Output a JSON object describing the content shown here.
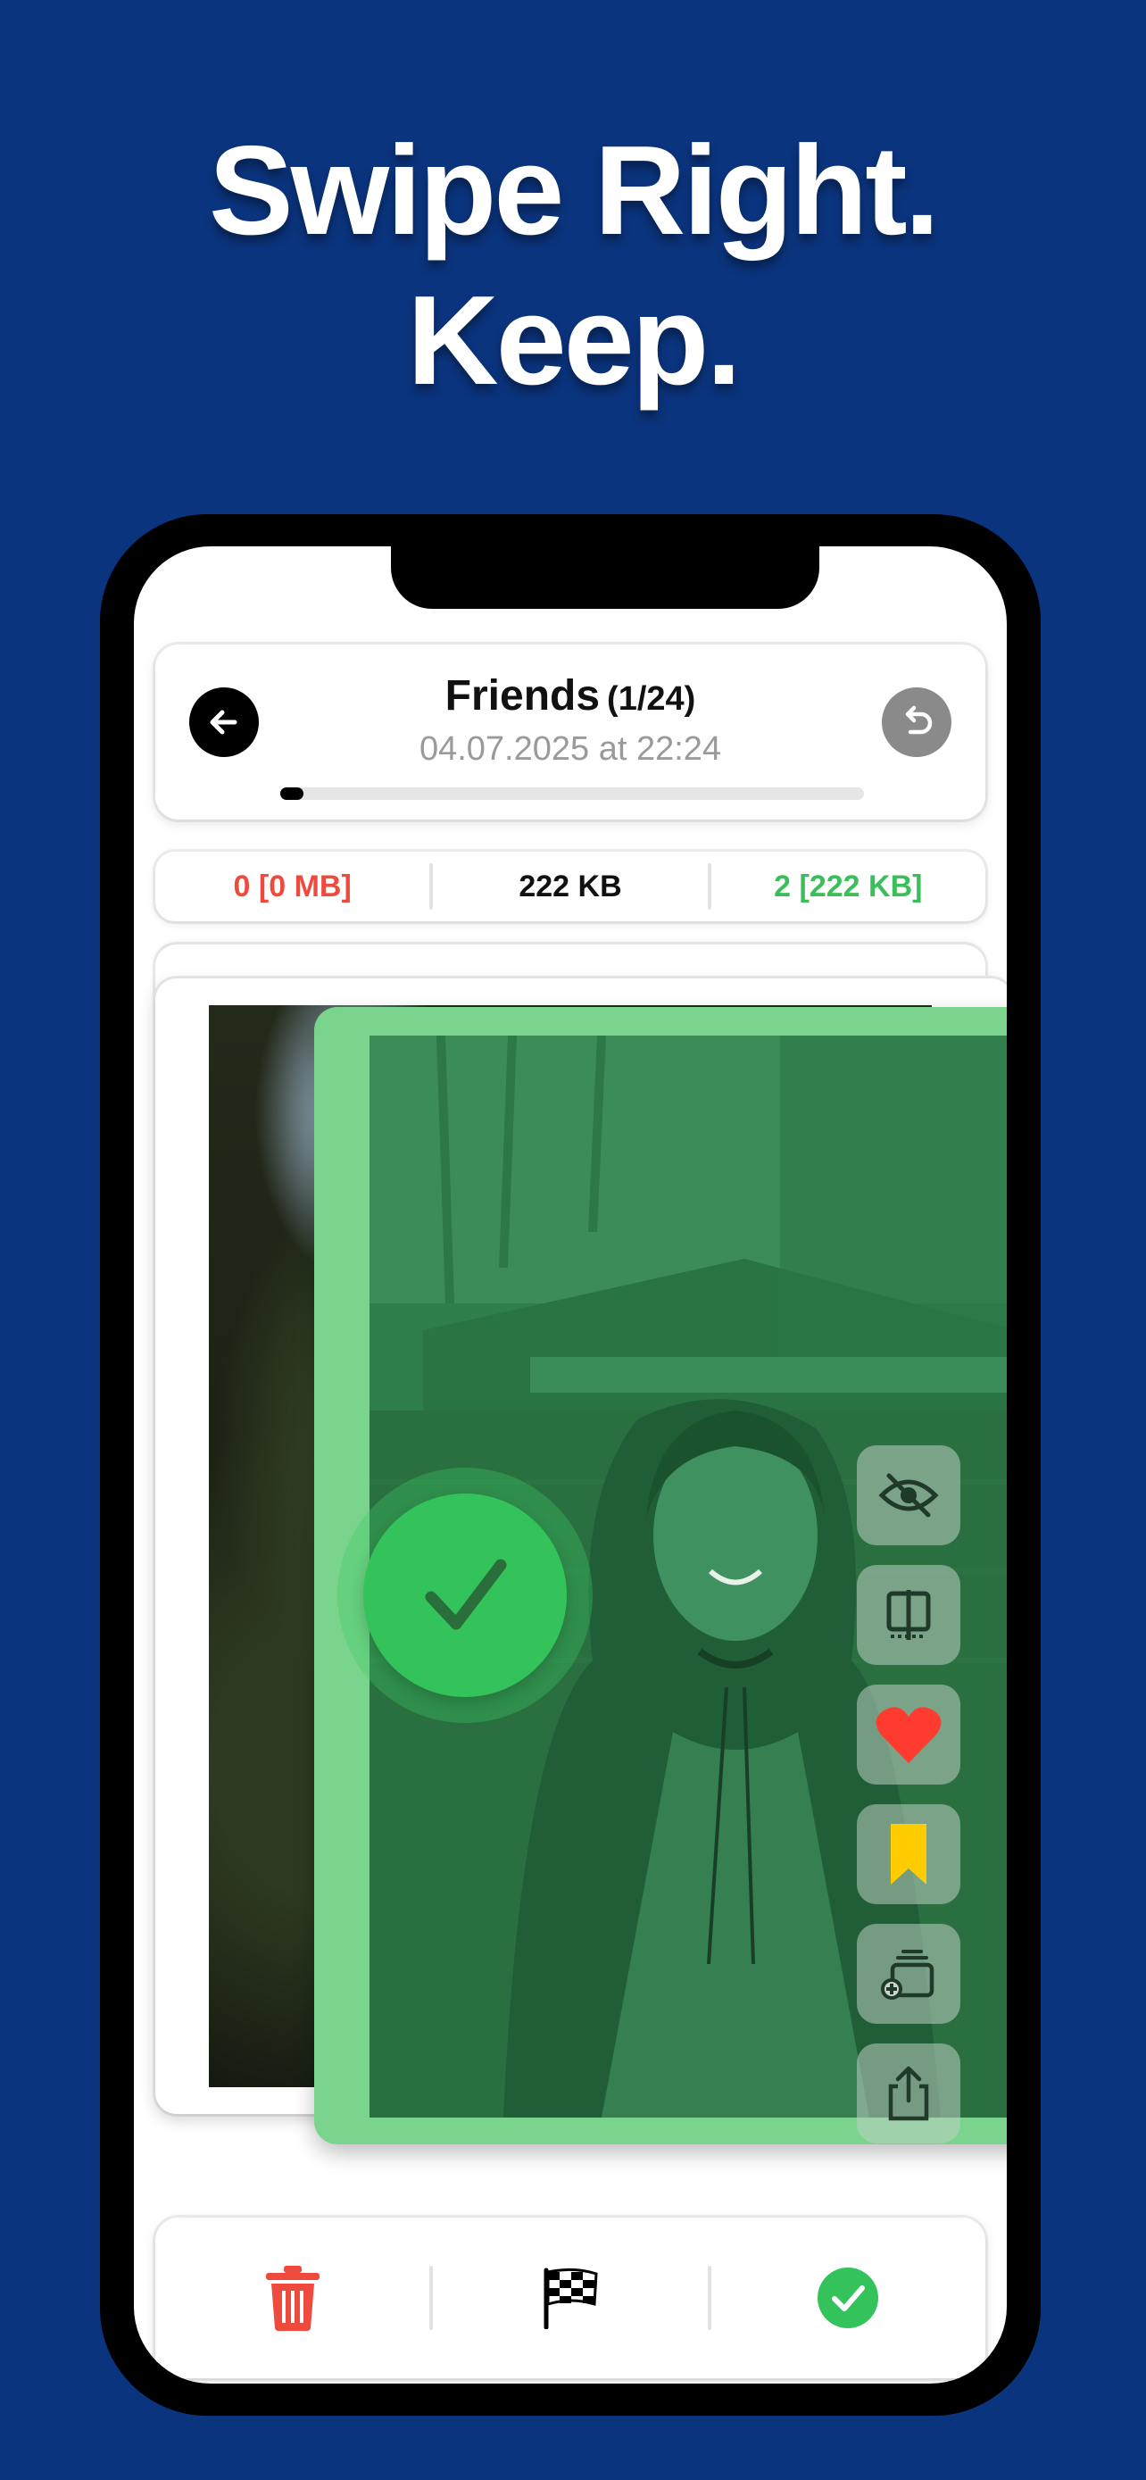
{
  "headline": {
    "line1": "Swipe Right.",
    "line2": "Keep."
  },
  "header": {
    "title": "Friends",
    "counter": "(1/24)",
    "date": "04.07.2025 at 22:24",
    "progress": 0.04
  },
  "stats": {
    "deleted": "0 [0 MB]",
    "current_size": "222 KB",
    "kept": "2 [222 KB]"
  },
  "colors": {
    "background": "#0b347e",
    "delete": "#ee4b3e",
    "keep": "#34c35a",
    "favorite": "#ff3b30",
    "bookmark": "#ffcc00"
  },
  "icons": {
    "back": "arrow-left-icon",
    "undo": "undo-icon",
    "keep_overlay": "checkmark-icon",
    "tools": [
      "eye-slash-icon",
      "compare-icon",
      "heart-icon",
      "bookmark-icon",
      "add-to-album-icon",
      "share-icon"
    ],
    "bottom": [
      "trash-icon",
      "checkered-flag-icon",
      "checkmark-circle-icon"
    ]
  }
}
